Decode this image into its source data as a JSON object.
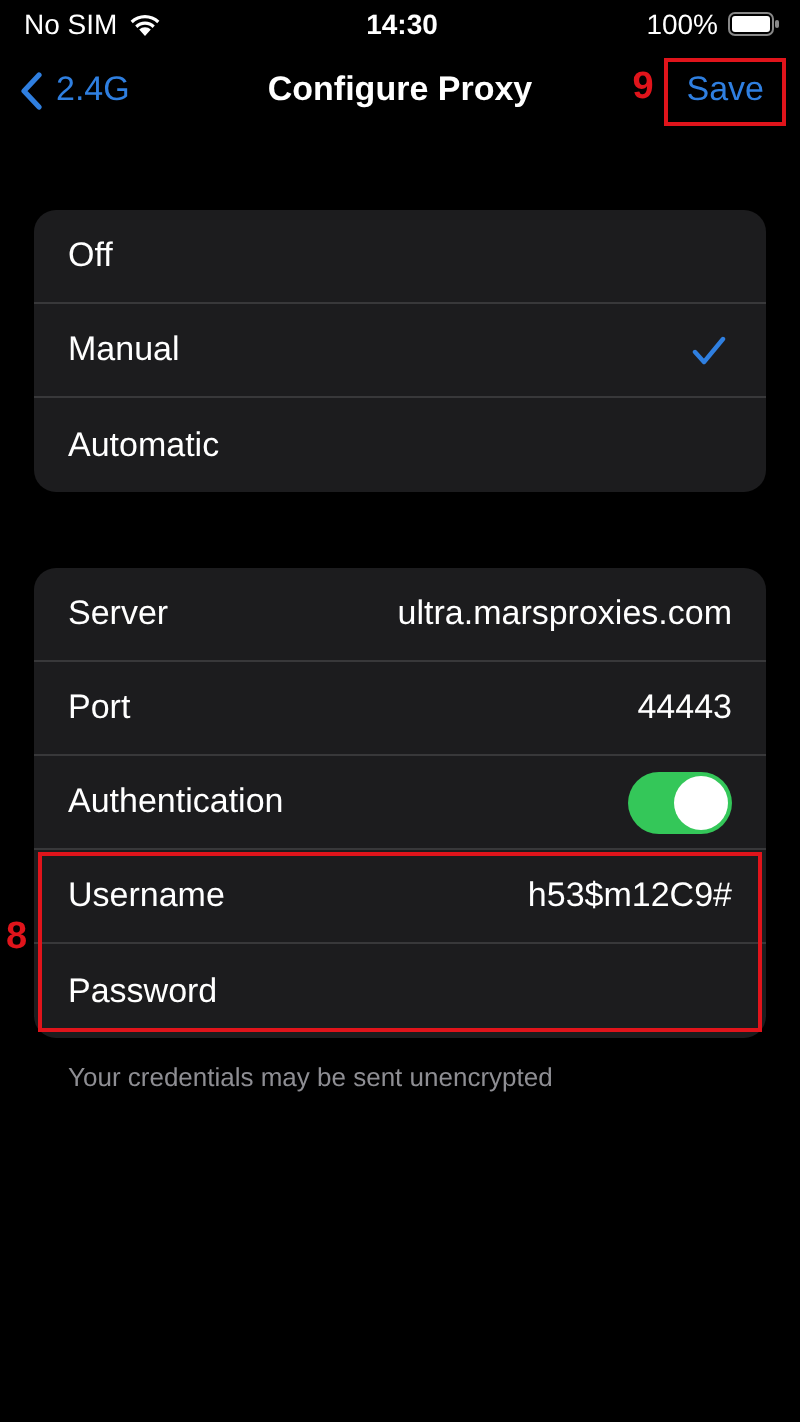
{
  "status_bar": {
    "carrier": "No SIM",
    "time": "14:30",
    "battery": "100%"
  },
  "nav": {
    "back": "2.4G",
    "title": "Configure Proxy",
    "action": "Save",
    "annotation": "9"
  },
  "proxy_modes": [
    {
      "label": "Off",
      "selected": false
    },
    {
      "label": "Manual",
      "selected": true
    },
    {
      "label": "Automatic",
      "selected": false
    }
  ],
  "fields": [
    {
      "kind": "text",
      "label": "Server",
      "value": "ultra.marsproxies.com"
    },
    {
      "kind": "text",
      "label": "Port",
      "value": "44443"
    },
    {
      "kind": "toggle",
      "label": "Authentication",
      "on": true
    },
    {
      "kind": "text",
      "label": "Username",
      "value": "h53$m12C9#"
    },
    {
      "kind": "text",
      "label": "Password"
    }
  ],
  "footer": "Your credentials may be sent unencrypted",
  "credentials_annotation": "8"
}
